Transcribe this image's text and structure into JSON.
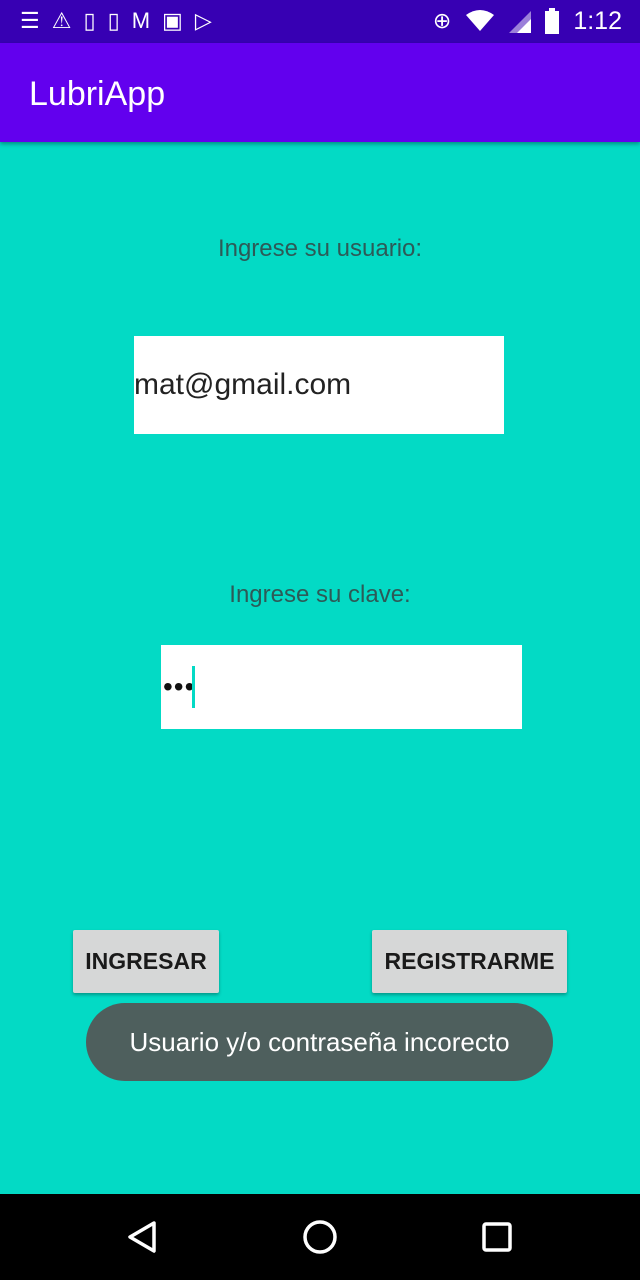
{
  "status_bar": {
    "time": "1:12",
    "left_icons": [
      "notes-icon",
      "warning-icon",
      "phone-sync-icon",
      "phone-sync-icon",
      "gmail-icon",
      "image-icon",
      "play-store-icon"
    ],
    "right_icons": [
      "data-saver-icon",
      "wifi-icon",
      "signal-icon",
      "battery-icon"
    ]
  },
  "app_bar": {
    "title": "LubriApp"
  },
  "form": {
    "user_label": "Ingrese su usuario:",
    "user_value": "mat@gmail.com",
    "pass_label": "Ingrese su clave:",
    "pass_masked": "•••"
  },
  "buttons": {
    "login_label": "INGRESAR",
    "register_label": "REGISTRARME"
  },
  "toast": {
    "message": "Usuario y/o contraseña incorecto"
  },
  "colors": {
    "status_bar": "#3700b3",
    "app_bar": "#6200ee",
    "background": "#03dac5",
    "toast": "#4e5f5d"
  }
}
